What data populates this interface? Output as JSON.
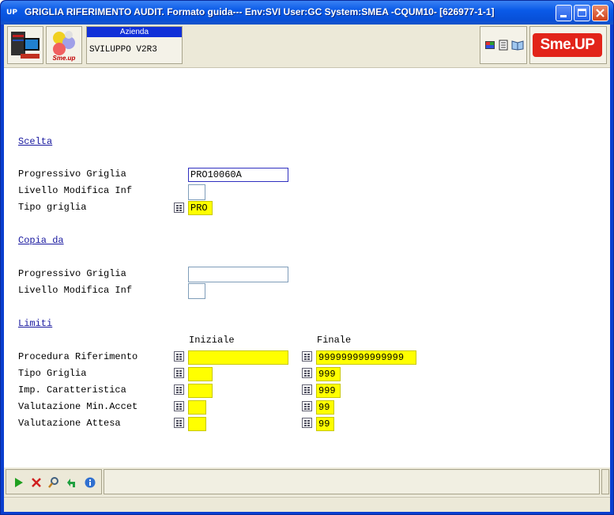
{
  "window": {
    "title": "GRIGLIA RIFERIMENTO AUDIT.  Formato guida--- Env:SVI User:GC System:SMEA -CQUM10- [626977-1-1]",
    "app_icon": "UP"
  },
  "toolbar": {
    "azienda_label": "Azienda",
    "azienda_value": "SVILUPPO V2R3",
    "brand": "Sme.UP"
  },
  "sections": {
    "scelta": "Scelta",
    "copia_da": "Copia da",
    "limiti": "Limiti"
  },
  "scelta": {
    "progressivo_label": "Progressivo Griglia",
    "progressivo_value": "PRO10060A",
    "livello_label": "Livello Modifica Inf",
    "livello_value": "",
    "tipo_label": "Tipo griglia",
    "tipo_value": "PRO"
  },
  "copia_da": {
    "progressivo_label": "Progressivo Griglia",
    "progressivo_value": "",
    "livello_label": "Livello Modifica Inf",
    "livello_value": ""
  },
  "limiti": {
    "col_iniziale": "Iniziale",
    "col_finale": "Finale",
    "rows": [
      {
        "label": "Procedura Riferimento",
        "iniziale": "",
        "finale": "999999999999999"
      },
      {
        "label": "Tipo Griglia",
        "iniziale": "",
        "finale": "999"
      },
      {
        "label": "Imp. Caratteristica",
        "iniziale": "",
        "finale": "999"
      },
      {
        "label": "Valutazione Min.Accet",
        "iniziale": "",
        "finale": "99"
      },
      {
        "label": "Valutazione Attesa",
        "iniziale": "",
        "finale": "99"
      }
    ]
  },
  "bottom_icons": [
    "play-icon",
    "cancel-icon",
    "search-icon",
    "return-icon",
    "info-icon"
  ],
  "colors": {
    "title_blue": "#0a5ae8",
    "field_yellow": "#ffff00",
    "section_link": "#1a1aa0",
    "brand_red": "#e2241a"
  }
}
